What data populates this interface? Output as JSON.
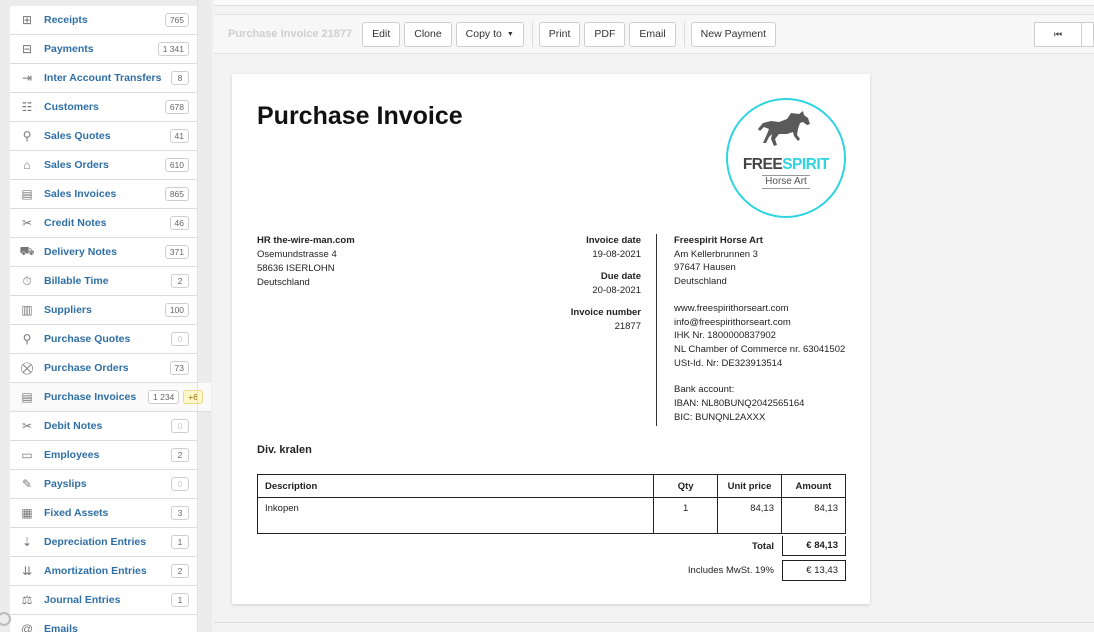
{
  "sidebar": {
    "items": [
      {
        "label": "Receipts",
        "badge": "765",
        "icon": "plus-square-icon"
      },
      {
        "label": "Payments",
        "badge": "1 341",
        "icon": "minus-square-icon"
      },
      {
        "label": "Inter Account Transfers",
        "badge": "8",
        "icon": "transfer-icon"
      },
      {
        "label": "Customers",
        "badge": "678",
        "icon": "customers-icon"
      },
      {
        "label": "Sales Quotes",
        "badge": "41",
        "icon": "compass-icon"
      },
      {
        "label": "Sales Orders",
        "badge": "610",
        "icon": "basket-icon"
      },
      {
        "label": "Sales Invoices",
        "badge": "865",
        "icon": "document-icon"
      },
      {
        "label": "Credit Notes",
        "badge": "46",
        "icon": "scissors-icon"
      },
      {
        "label": "Delivery Notes",
        "badge": "371",
        "icon": "truck-icon"
      },
      {
        "label": "Billable Time",
        "badge": "2",
        "icon": "stopwatch-icon"
      },
      {
        "label": "Suppliers",
        "badge": "100",
        "icon": "factory-icon"
      },
      {
        "label": "Purchase Quotes",
        "badge": "0",
        "icon": "compass-icon"
      },
      {
        "label": "Purchase Orders",
        "badge": "73",
        "icon": "cart-icon"
      },
      {
        "label": "Purchase Invoices",
        "badge": "1 234",
        "badge_new": "+6",
        "icon": "document-icon"
      },
      {
        "label": "Debit Notes",
        "badge": "0",
        "icon": "scissors-icon"
      },
      {
        "label": "Employees",
        "badge": "2",
        "icon": "id-card-icon"
      },
      {
        "label": "Payslips",
        "badge": "0",
        "icon": "payslip-icon"
      },
      {
        "label": "Fixed Assets",
        "badge": "3",
        "icon": "building-icon"
      },
      {
        "label": "Depreciation Entries",
        "badge": "1",
        "icon": "sort-down-icon"
      },
      {
        "label": "Amortization Entries",
        "badge": "2",
        "icon": "sort-amount-icon"
      },
      {
        "label": "Journal Entries",
        "badge": "1",
        "icon": "scale-icon"
      },
      {
        "label": "Emails",
        "badge": "",
        "icon": "at-icon"
      }
    ]
  },
  "toolbar": {
    "title": "Purchase Invoice 21877",
    "edit": "Edit",
    "clone": "Clone",
    "copy_to": "Copy to",
    "print": "Print",
    "pdf": "PDF",
    "email": "Email",
    "new_payment": "New Payment",
    "first": "⏮"
  },
  "document": {
    "title": "Purchase Invoice",
    "logo": {
      "free": "FREE",
      "spirit": "SPIRIT",
      "sub": "Horse Art"
    },
    "billed_to": {
      "name": "HR the-wire-man.com",
      "line1": "Osemundstrasse 4",
      "line2": "58636 ISERLOHN",
      "line3": "Deutschland"
    },
    "meta": {
      "invoice_date_label": "Invoice date",
      "invoice_date": "19-08-2021",
      "due_date_label": "Due date",
      "due_date": "20-08-2021",
      "invoice_number_label": "Invoice number",
      "invoice_number": "21877"
    },
    "supplier": {
      "name": "Freespirit Horse Art",
      "line1": "Am Kellerbrunnen 3",
      "line2": "97647 Hausen",
      "line3": "Deutschland",
      "web": "www.freespirithorseart.com",
      "mail": "info@freespirithorseart.com",
      "ihk": "IHK Nr. 1800000837902",
      "nl": "NL Chamber of Commerce nr. 63041502",
      "ust": "USt-Id. Nr: DE323913514",
      "bank": "Bank account:",
      "iban": "IBAN: NL80BUNQ2042565164",
      "bic": "BIC: BUNQNL2AXXX"
    },
    "subject": "Div. kralen",
    "table": {
      "headers": {
        "description": "Description",
        "qty": "Qty",
        "unit_price": "Unit price",
        "amount": "Amount"
      },
      "rows": [
        {
          "description": "Inkopen",
          "qty": "1",
          "unit_price": "84,13",
          "amount": "84,13"
        }
      ]
    },
    "totals": {
      "total_label": "Total",
      "total": "€ 84,13",
      "vat_label": "Includes MwSt. 19%",
      "vat": "€ 13,43"
    }
  },
  "colors": {
    "link": "#2f6fa6",
    "logo_accent": "#2fd4e0"
  }
}
